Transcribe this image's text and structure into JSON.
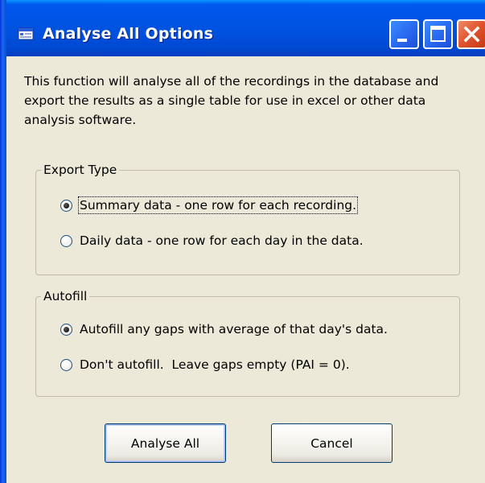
{
  "window": {
    "title": "Analyse All Options",
    "icon": "app-window-icon",
    "controls": {
      "minimize": "minimize-icon",
      "maximize": "maximize-icon",
      "close": "close-icon"
    }
  },
  "intro": {
    "text": "This function will analyse all of the recordings in the database and export the results as a single table for use in excel or other data analysis software."
  },
  "export_type": {
    "label": "Export Type",
    "options": [
      {
        "label": "Summary data - one row for each recording.",
        "selected": true
      },
      {
        "label": "Daily data - one row for each day in the data.",
        "selected": false
      }
    ]
  },
  "autofill": {
    "label": "Autofill",
    "options": [
      {
        "label": "Autofill any gaps with average of that day's data.",
        "selected": true
      },
      {
        "label": "Don't autofill.  Leave gaps empty (PAI = 0).",
        "selected": false
      }
    ]
  },
  "buttons": {
    "analyse_all": "Analyse All",
    "cancel": "Cancel"
  },
  "colors": {
    "titlebar": "#0054e3",
    "dialog_background": "#ece9d8",
    "close_button": "#e0532d"
  }
}
